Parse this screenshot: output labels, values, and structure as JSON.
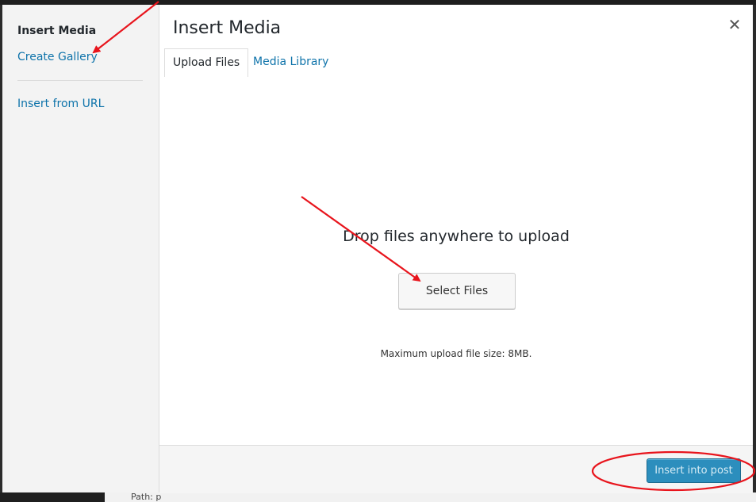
{
  "menu": {
    "title": "Insert Media",
    "items": [
      {
        "label": "Create Gallery"
      },
      {
        "label": "Insert from URL"
      }
    ]
  },
  "frame": {
    "title": "Insert Media",
    "close_icon": "close-icon"
  },
  "tabs": [
    {
      "label": "Upload Files",
      "active": true
    },
    {
      "label": "Media Library",
      "active": false
    }
  ],
  "uploader": {
    "drop_text": "Drop files anywhere to upload",
    "select_button": "Select Files",
    "max_size": "Maximum upload file size: 8MB."
  },
  "toolbar": {
    "insert_button": "Insert into post"
  },
  "background": {
    "path_label": "Path: p"
  },
  "colors": {
    "link": "#0e73aa",
    "primary_button": "#2c8ebd",
    "annotation": "#e8141c"
  }
}
